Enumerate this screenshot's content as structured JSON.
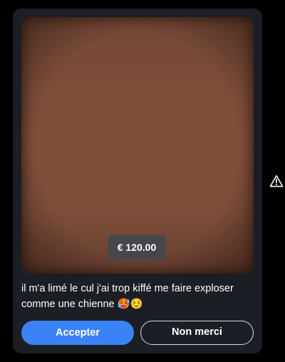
{
  "offer": {
    "price": "€ 120.00",
    "message": "il m'a limé le cul j'ai trop kiffé me faire exploser comme une chienne 🥵☺️",
    "accept_label": "Accepter",
    "decline_label": "Non merci"
  },
  "icons": {
    "warning": "warning-icon"
  },
  "colors": {
    "card_background": "#1b1e24",
    "media_placeholder": "#7e4e3a",
    "accept_button": "#3b82f6",
    "price_badge": "#45474c"
  }
}
